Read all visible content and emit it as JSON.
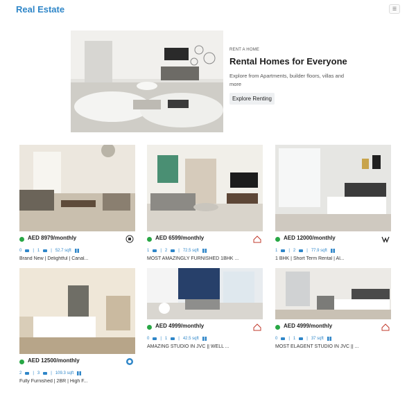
{
  "navbar": {
    "brand": "Real Estate",
    "menu_icon": "hamburger-icon"
  },
  "hero": {
    "eyebrow": "RENT A HOME",
    "title": "Rental Homes for Everyone",
    "description": "Explore from Apartments, builder floors, villas and more",
    "button_label": "Explore Renting"
  },
  "listings": [
    {
      "price": "AED 8979/monthly",
      "beds": "0",
      "baths": "1",
      "area": "52.7 sqft",
      "title": "Brand New | Delightful | Canal...",
      "logo_color": "#333333"
    },
    {
      "price": "AED 6599/monthly",
      "beds": "1",
      "baths": "2",
      "area": "72.5 sqft",
      "title": "MOST AMAZINGLY FURNISHED 1BHK ...",
      "logo_color": "#c0392b"
    },
    {
      "price": "AED 12000/monthly",
      "beds": "1",
      "baths": "2",
      "area": "77.9 sqft",
      "title": "1 BHK | Short Term Rental | Al...",
      "logo_color": "#1a1a1a"
    },
    {
      "price": "AED 12500/monthly",
      "beds": "2",
      "baths": "3",
      "area": "109.3 sqft",
      "title": "Fully Furnished | 2BR | High F...",
      "logo_color": "#2f86c8"
    },
    {
      "price": "AED 4999/monthly",
      "beds": "0",
      "baths": "1",
      "area": "42.5 sqft",
      "title": "AMAZING STUDIO IN JVC || WELL ...",
      "logo_color": "#c0392b"
    },
    {
      "price": "AED 4999/monthly",
      "beds": "0",
      "baths": "1",
      "area": "37 sqft",
      "title": "MOST ELAGENT STUDIO IN JVC || ...",
      "logo_color": "#c0392b"
    }
  ]
}
